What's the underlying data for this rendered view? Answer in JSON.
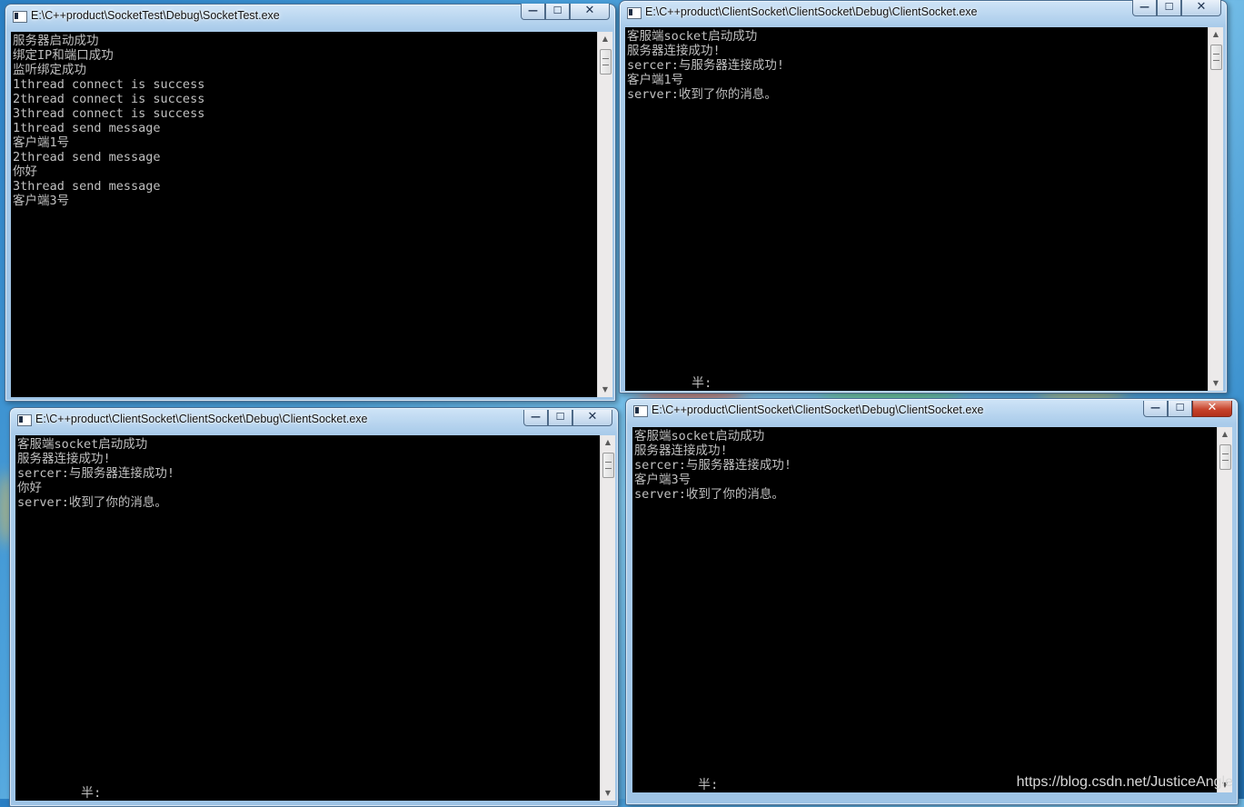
{
  "windows": [
    {
      "title": "E:\\C++product\\SocketTest\\Debug\\SocketTest.exe",
      "lines": [
        "服务器启动成功",
        "绑定IP和端口成功",
        "监听绑定成功",
        "1thread connect is success",
        "2thread connect is success",
        "3thread connect is success",
        "1thread send message",
        "客户端1号",
        "2thread send message",
        "你好",
        "3thread send message",
        "客户端3号"
      ],
      "ime": ""
    },
    {
      "title": "E:\\C++product\\ClientSocket\\ClientSocket\\Debug\\ClientSocket.exe",
      "lines": [
        "客服端socket启动成功",
        "服务器连接成功!",
        "sercer:与服务器连接成功!",
        "客户端1号",
        "server:收到了你的消息。"
      ],
      "ime": "半:"
    },
    {
      "title": "E:\\C++product\\ClientSocket\\ClientSocket\\Debug\\ClientSocket.exe",
      "lines": [
        "客服端socket启动成功",
        "服务器连接成功!",
        "sercer:与服务器连接成功!",
        "你好",
        "server:收到了你的消息。"
      ],
      "ime": "半:"
    },
    {
      "title": "E:\\C++product\\ClientSocket\\ClientSocket\\Debug\\ClientSocket.exe",
      "lines": [
        "客服端socket启动成功",
        "服务器连接成功!",
        "sercer:与服务器连接成功!",
        "客户端3号",
        "server:收到了你的消息。"
      ],
      "ime": "半:"
    }
  ],
  "controls": {
    "minimize": "—",
    "maximize": "☐",
    "close": "✕"
  },
  "watermark": "https://blog.csdn.net/JusticeAngle"
}
